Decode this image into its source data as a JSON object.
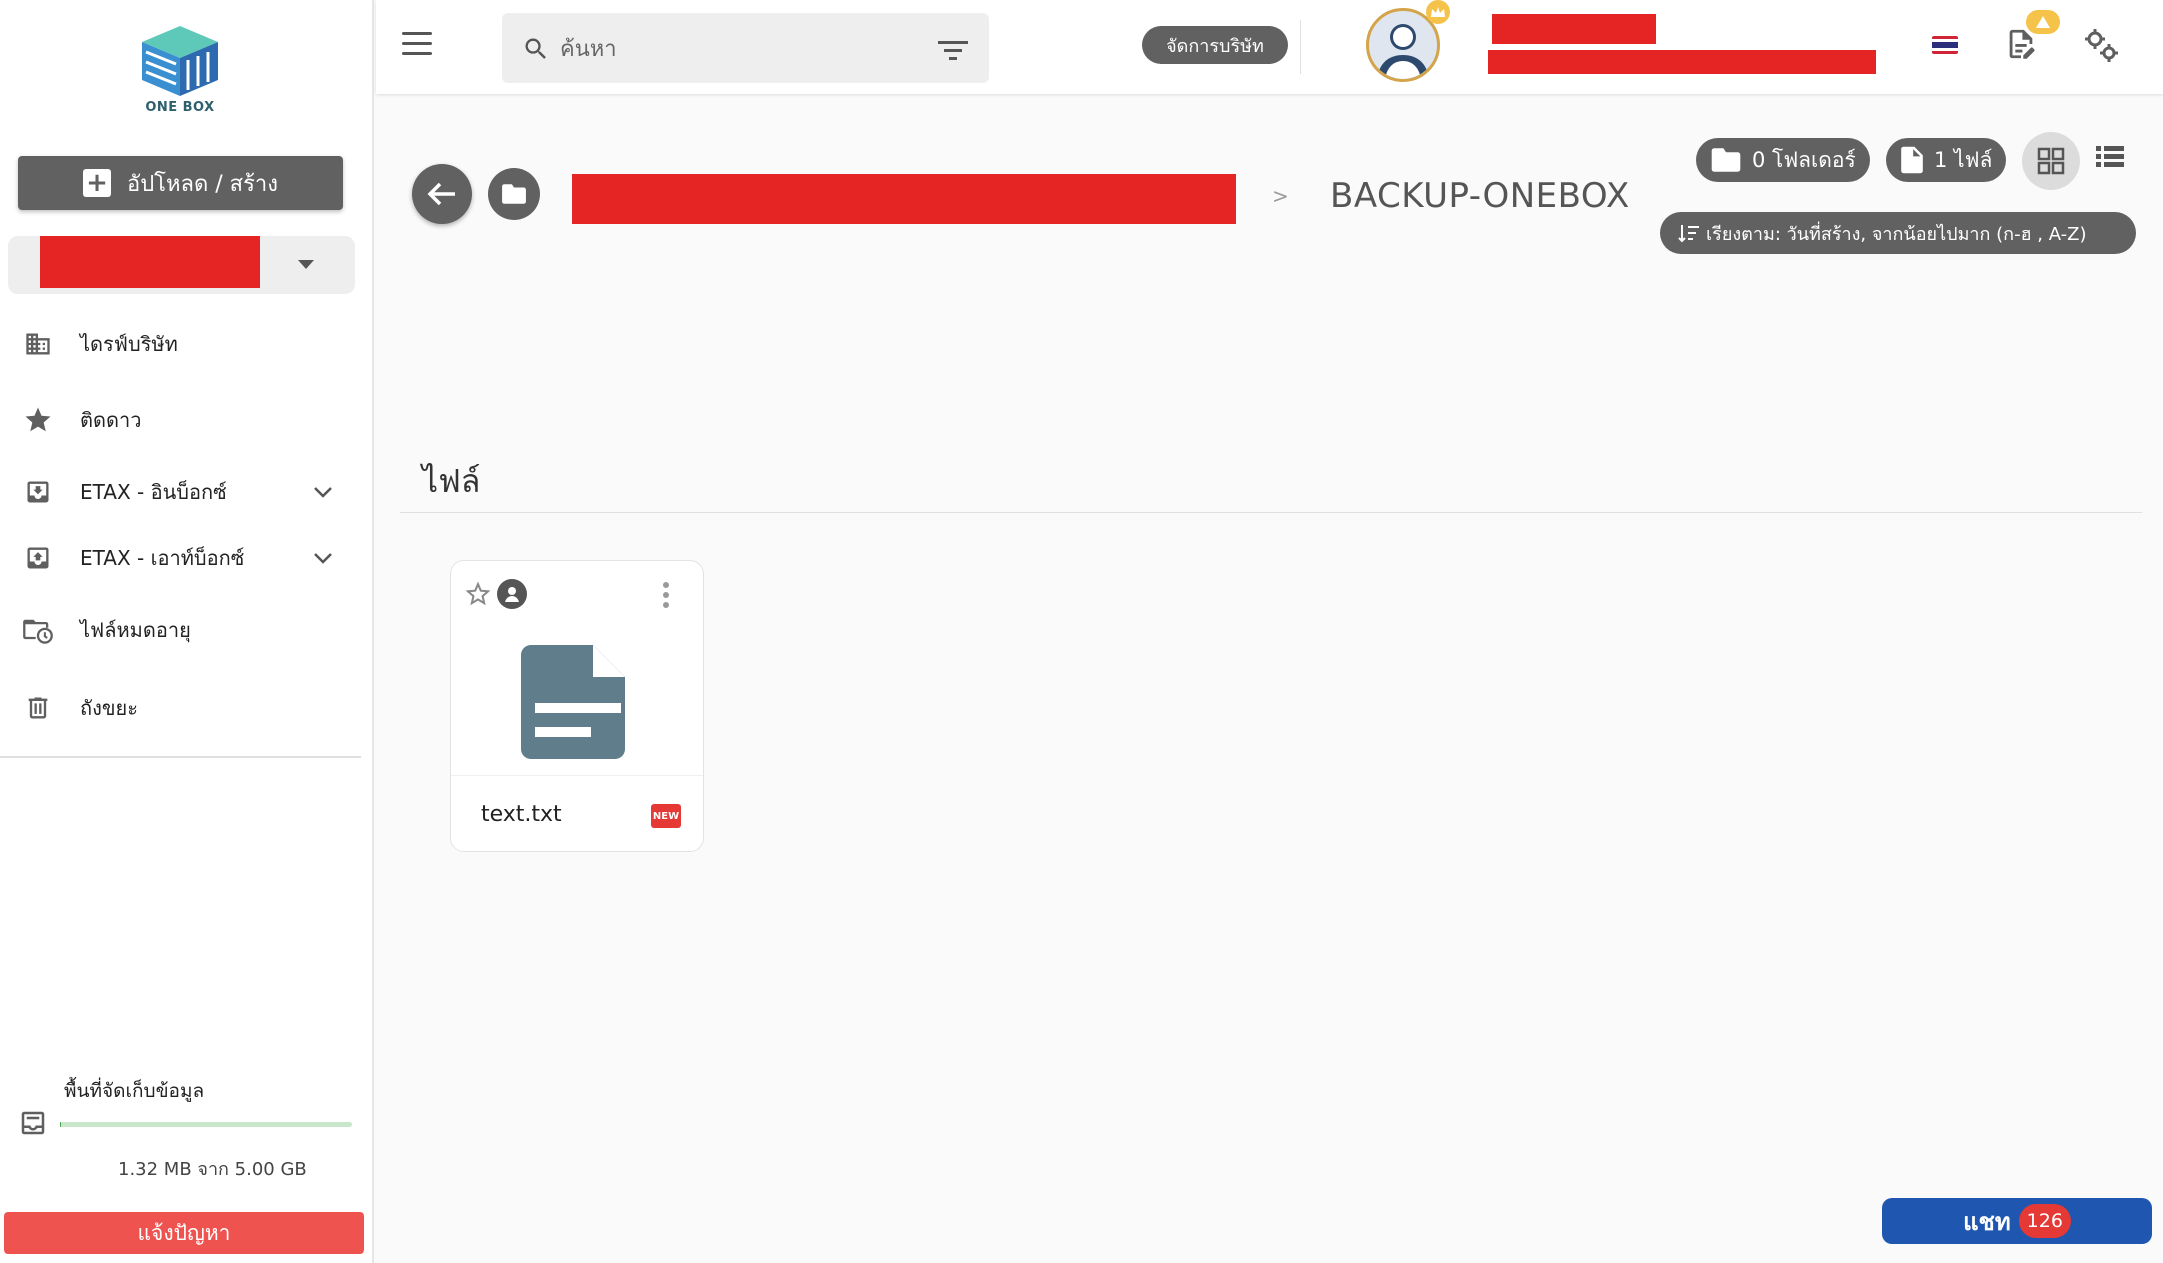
{
  "sidebar": {
    "logo_text": "ONE BOX",
    "upload_label": "อัปโหลด / สร้าง",
    "nav": [
      {
        "label": "ไดรฟ์บริษัท",
        "icon": "building-icon"
      },
      {
        "label": "ติดดาว",
        "icon": "star-icon"
      },
      {
        "label": "ETAX - อินบ็อกซ์",
        "icon": "inbox-download-icon"
      },
      {
        "label": "ETAX - เอาท์บ็อกซ์",
        "icon": "outbox-upload-icon"
      },
      {
        "label": "ไฟล์หมดอายุ",
        "icon": "folder-clock-icon"
      },
      {
        "label": "ถังขยะ",
        "icon": "trash-icon"
      }
    ],
    "storage": {
      "label": "พื้นที่จัดเก็บข้อมูล",
      "usage_text": "1.32 MB จาก 5.00 GB",
      "used_fraction": 0.0003
    },
    "report_label": "แจ้งปัญหา"
  },
  "topbar": {
    "search_placeholder": "ค้นหา",
    "manage_company_label": "จัดการบริษัท",
    "accent_color": "#1e56b0"
  },
  "main": {
    "breadcrumb_separator": ">",
    "breadcrumb_current": "BACKUP-ONEBOX",
    "folder_count_label": "0 โฟลเดอร์",
    "file_count_label": "1 ไฟล์",
    "sort_label": "เรียงตาม: วันที่สร้าง, จากน้อยไปมาก (ก-ฮ , A-Z)",
    "section_title": "ไฟล์",
    "files": [
      {
        "name": "text.txt",
        "badge": "NEW",
        "icon": "text-document-icon"
      }
    ]
  },
  "chat": {
    "label": "แชท",
    "count": "126"
  }
}
